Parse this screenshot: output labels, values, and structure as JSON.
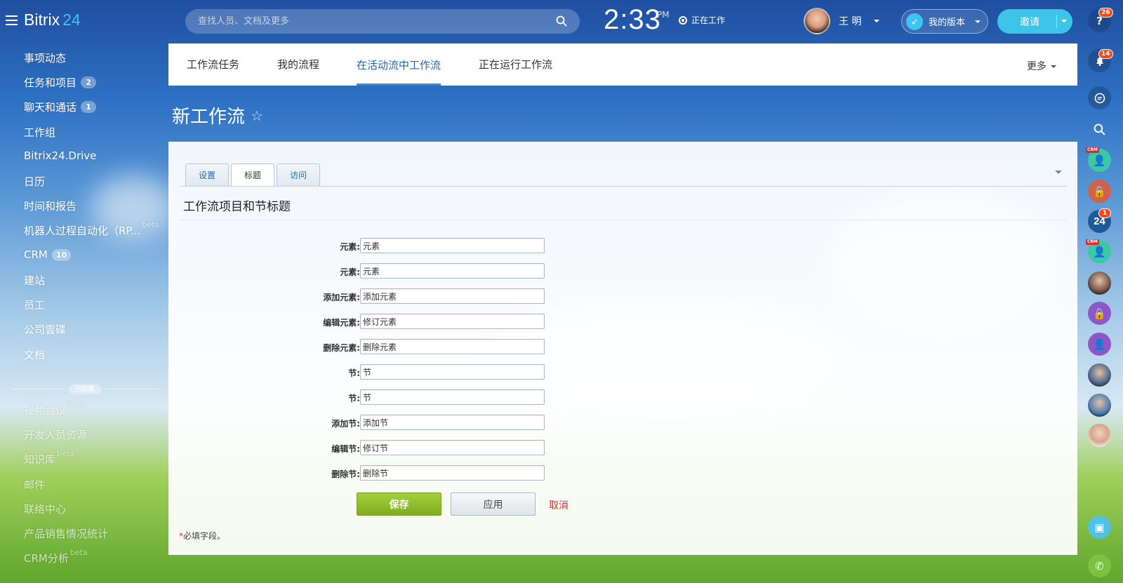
{
  "header": {
    "logo_name": "Bitrix",
    "logo_num": "24",
    "search_placeholder": "查找人员、文档及更多",
    "time": "2:33",
    "ampm": "PM",
    "work_status": "正在工作",
    "user_name": "王 明",
    "version_label": "我的版本",
    "invite_label": "邀请"
  },
  "sidebar": {
    "items": [
      {
        "label": "事项动态",
        "badge": "",
        "beta": ""
      },
      {
        "label": "任务和项目",
        "badge": "2",
        "beta": ""
      },
      {
        "label": "聊天和通话",
        "badge": "1",
        "beta": ""
      },
      {
        "label": "工作组",
        "badge": "",
        "beta": ""
      },
      {
        "label": "Bitrix24.Drive",
        "badge": "",
        "beta": ""
      },
      {
        "label": "日历",
        "badge": "",
        "beta": ""
      },
      {
        "label": "时间和报告",
        "badge": "",
        "beta": ""
      },
      {
        "label": "机器人过程自动化（RP...",
        "badge": "",
        "beta": "beta"
      },
      {
        "label": "CRM",
        "badge": "10",
        "beta": ""
      },
      {
        "label": "建站",
        "badge": "",
        "beta": ""
      },
      {
        "label": "员工",
        "badge": "",
        "beta": ""
      },
      {
        "label": "公司雲碟",
        "badge": "",
        "beta": ""
      },
      {
        "label": "文档",
        "badge": "",
        "beta": ""
      }
    ],
    "hidden_label": "已隐藏",
    "hidden_items": [
      {
        "label": "视频会议",
        "beta": "beta"
      },
      {
        "label": "开发人员资源",
        "beta": ""
      },
      {
        "label": "知识库",
        "beta": "beta"
      },
      {
        "label": "邮件",
        "beta": ""
      },
      {
        "label": "联络中心",
        "beta": ""
      },
      {
        "label": "产品销售情况统计",
        "beta": ""
      },
      {
        "label": "CRM分析",
        "beta": "beta"
      }
    ]
  },
  "top_tabs": [
    "工作流任务",
    "我的流程",
    "在活动流中工作流",
    "正在运行工作流"
  ],
  "top_tabs_more": "更多",
  "page_title": "新工作流",
  "form": {
    "tabs": [
      "设置",
      "标题",
      "访问"
    ],
    "section_title": "工作流项目和节标题",
    "fields": [
      {
        "label": "元素:",
        "value": "元素"
      },
      {
        "label": "元素:",
        "value": "元素"
      },
      {
        "label": "添加元素:",
        "value": "添加元素"
      },
      {
        "label": "编辑元素:",
        "value": "修订元素"
      },
      {
        "label": "删除元素:",
        "value": "删除元素"
      },
      {
        "label": "节:",
        "value": "节"
      },
      {
        "label": "节:",
        "value": "节"
      },
      {
        "label": "添加节:",
        "value": "添加节"
      },
      {
        "label": "编辑节:",
        "value": "修订节"
      },
      {
        "label": "删除节:",
        "value": "删除节"
      }
    ],
    "save_label": "保存",
    "apply_label": "应用",
    "cancel_label": "取消",
    "required_asterisk": "*",
    "required_note": "必填字段。"
  },
  "rail": {
    "help_badge": "26",
    "notify_badge": "14",
    "b24_label": "24",
    "b24_badge": "1",
    "crm_tag": "CRM"
  }
}
